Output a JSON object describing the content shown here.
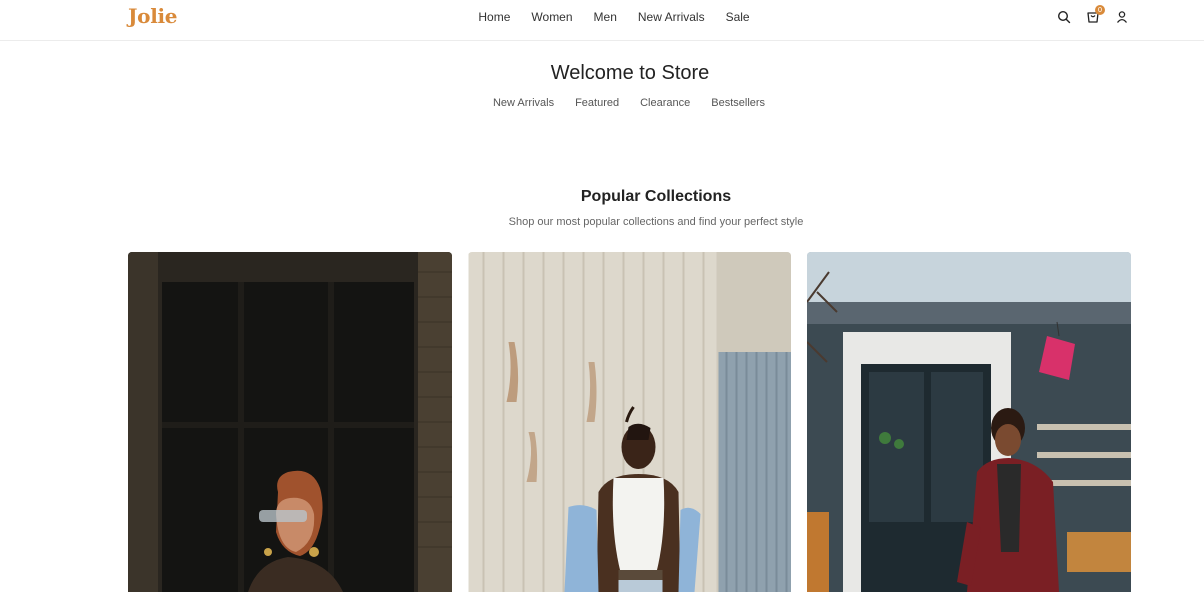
{
  "brand": {
    "logo": "Jolie",
    "accent": "#d98a3a"
  },
  "nav": {
    "items": [
      "Home",
      "Women",
      "Men",
      "New Arrivals",
      "Sale"
    ]
  },
  "header_icons": {
    "search": "search-icon",
    "cart": "cart-icon",
    "cart_count": "0",
    "account": "user-icon"
  },
  "hero": {
    "title": "Welcome to Store",
    "links": [
      "New Arrivals",
      "Featured",
      "Clearance",
      "Bestsellers"
    ]
  },
  "collections": {
    "title": "Popular Collections",
    "subtitle": "Shop our most popular collections and find your perfect style",
    "cards": [
      {
        "image": "woman-with-sunglasses-photo"
      },
      {
        "image": "man-white-tank-top-photo"
      },
      {
        "image": "woman-red-coat-storefront-photo"
      }
    ]
  }
}
